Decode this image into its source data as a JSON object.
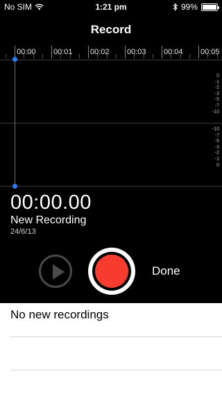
{
  "status_bar": {
    "carrier": "No SIM",
    "time": "1:21 pm",
    "battery_percent": "99%",
    "battery_level": 0.99,
    "icons": [
      "wifi-icon",
      "bluetooth-icon",
      "battery-icon"
    ]
  },
  "nav": {
    "title": "Record"
  },
  "timeline": {
    "labels": [
      "00:00",
      "00:01",
      "00:02",
      "00:03",
      "00:04",
      "00:05"
    ]
  },
  "waveform": {
    "db_upper": [
      "0",
      "-1",
      "-2",
      "-3",
      "-5",
      "-7",
      "-10"
    ],
    "db_lower": [
      "-10",
      "-7",
      "-5",
      "-3",
      "-2",
      "-1",
      "0"
    ],
    "playhead_color": "#2d7cf6"
  },
  "recording": {
    "timer": "00:00.00",
    "name": "New Recording",
    "date": "24/6/13"
  },
  "controls": {
    "play_icon": "play-icon",
    "record_color": "#f53c2f",
    "done_label": "Done"
  },
  "list": {
    "empty_label": "No new recordings"
  }
}
